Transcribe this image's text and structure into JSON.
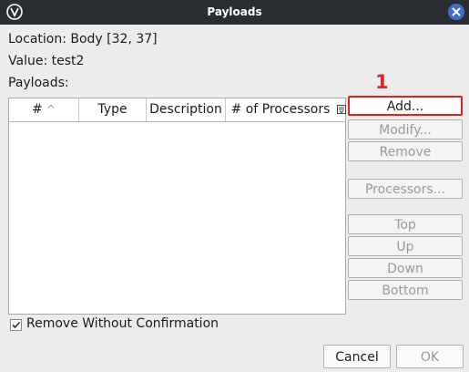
{
  "window": {
    "title": "Payloads"
  },
  "info": {
    "location": "Location: Body [32, 37]",
    "value": "Value: test2",
    "payloads_label": "Payloads:"
  },
  "table": {
    "columns": [
      "#",
      "Type",
      "Description",
      "# of Processors"
    ],
    "sort_indicator": "^",
    "rows": []
  },
  "buttons": {
    "add": "Add...",
    "modify": "Modify...",
    "remove": "Remove",
    "processors": "Processors...",
    "top": "Top",
    "up": "Up",
    "down": "Down",
    "bottom": "Bottom"
  },
  "annotation": "1",
  "checkbox": {
    "label": "Remove Without Confirmation",
    "checked": true
  },
  "footer": {
    "cancel": "Cancel",
    "ok": "OK"
  },
  "colors": {
    "annotation_red": "#e02424",
    "titlebar": "#2a2e33",
    "close_button": "#3d6fd1"
  }
}
